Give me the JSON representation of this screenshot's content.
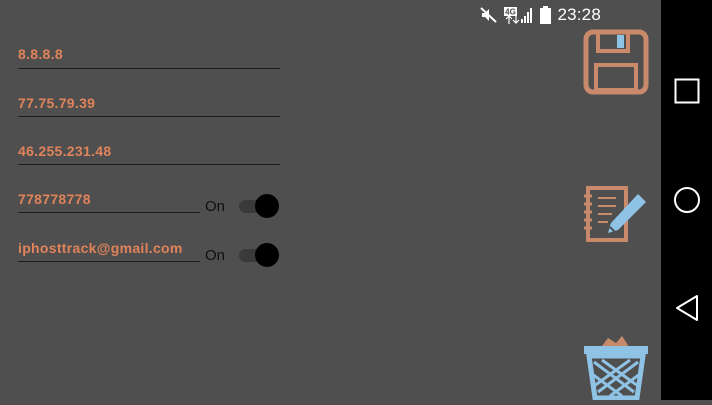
{
  "status_bar": {
    "time": "23:28",
    "network": "4G",
    "icons": [
      "mute-icon",
      "signal-icon",
      "battery-icon"
    ]
  },
  "fields": [
    {
      "value": "8.8.8.8"
    },
    {
      "value": "77.75.79.39"
    },
    {
      "value": "46.255.231.48"
    },
    {
      "value": "778778778",
      "toggle_label": "On"
    },
    {
      "value": "iphosttrack@gmail.com",
      "toggle_label": "On"
    }
  ],
  "actions": {
    "save": "save-floppy-icon",
    "edit": "edit-notepad-icon",
    "delete": "trash-bin-icon"
  },
  "navigation": {
    "back": "back-triangle-icon",
    "home": "home-circle-icon",
    "recents": "recents-square-icon"
  },
  "colors": {
    "accent": "#e0835a",
    "background": "#4f4f4f",
    "icon_blue": "#8fc3e6",
    "icon_orange": "#c88a6a"
  }
}
